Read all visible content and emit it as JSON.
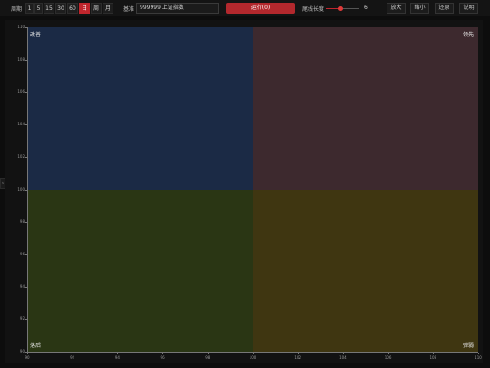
{
  "toolbar": {
    "period_label": "周期",
    "periods": [
      "1",
      "5",
      "15",
      "30",
      "60",
      "日",
      "周",
      "月"
    ],
    "active_period": "日",
    "benchmark_label": "基准",
    "benchmark_value": "999999 上证指数",
    "run_label": "运行(0)",
    "tail_label": "尾线长度",
    "tail_value": "6",
    "tail_fraction": 0.45,
    "zoom_in_label": "放大",
    "zoom_out_label": "缩小",
    "reset_label": "还原",
    "help_label": "说明"
  },
  "side_handle": "›",
  "quadrants": {
    "top_left": "改善",
    "top_right": "领先",
    "bottom_left": "落后",
    "bottom_right": "弹弱"
  },
  "chart_data": {
    "type": "scatter",
    "xlim": [
      90,
      110
    ],
    "ylim": [
      90,
      110
    ],
    "x_ticks": [
      "90",
      "92",
      "94",
      "96",
      "98",
      "100",
      "102",
      "104",
      "106",
      "108",
      "110"
    ],
    "y_ticks": [
      "110",
      "108",
      "106",
      "104",
      "102",
      "100",
      "98",
      "96",
      "94",
      "92",
      "90"
    ],
    "center": [
      100,
      100
    ],
    "quadrant_colors": {
      "top_left": "#1b2a45",
      "top_right": "#3d292e",
      "bottom_left": "#2a3614",
      "bottom_right": "#3f3611"
    },
    "series": []
  },
  "colors": {
    "accent": "#c0262d"
  }
}
